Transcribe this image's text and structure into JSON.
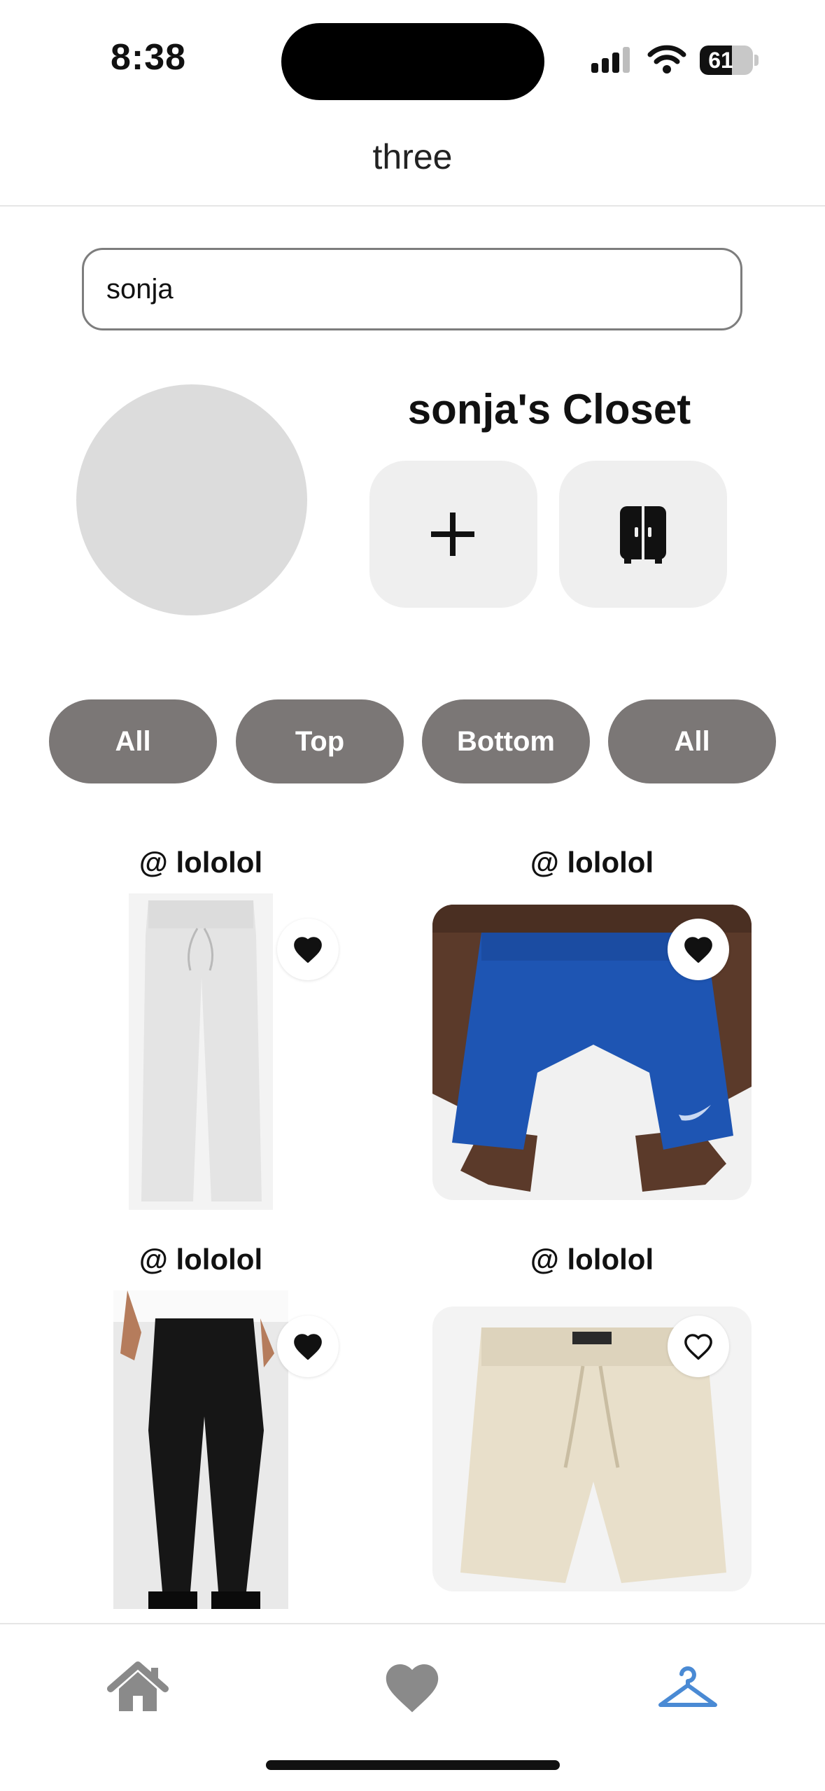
{
  "status_bar": {
    "time": "8:38",
    "battery": "61",
    "battery_level": 0.61
  },
  "header": {
    "title": "three"
  },
  "search": {
    "value": "sonja",
    "placeholder": ""
  },
  "profile": {
    "closet_title": "sonja's Closet"
  },
  "filters": [
    "All",
    "Top",
    "Bottom",
    "All"
  ],
  "items": [
    {
      "user": "@ lololol",
      "favorited": true
    },
    {
      "user": "@ lololol",
      "favorited": true
    },
    {
      "user": "@ lololol",
      "favorited": true
    },
    {
      "user": "@ lololol",
      "favorited": false
    }
  ],
  "tab_bar": {
    "tabs": [
      "home-icon",
      "heart-icon",
      "hanger-icon"
    ],
    "active_index": 2,
    "active_color": "#4a8ad4",
    "inactive_color": "#8a8a8a"
  }
}
